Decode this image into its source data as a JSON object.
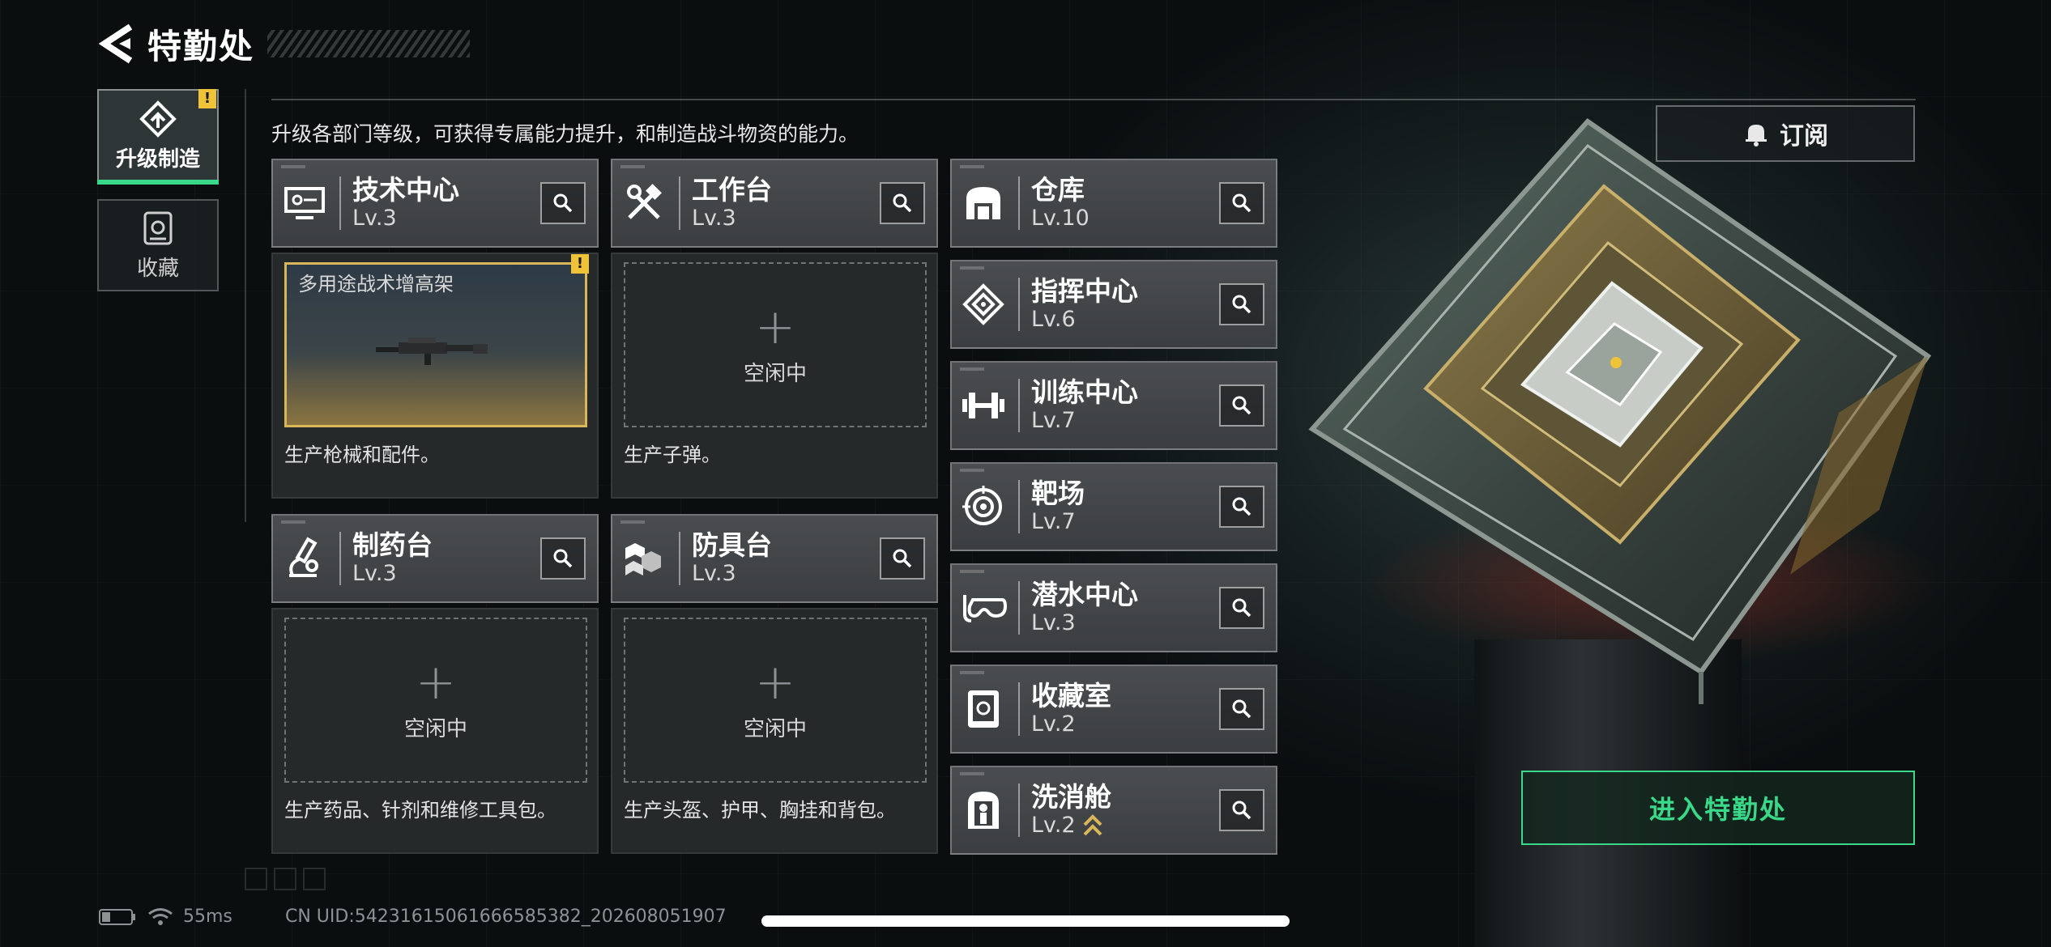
{
  "header": {
    "title": "特勤处"
  },
  "nav": {
    "tabs": [
      {
        "label": "升级制造",
        "badge": "!"
      },
      {
        "label": "收藏"
      }
    ]
  },
  "description": "升级各部门等级，可获得专属能力提升，和制造战斗物资的能力。",
  "subscribe_label": "订阅",
  "departments": {
    "tech_center": {
      "name": "技术中心",
      "level": "Lv.3"
    },
    "workbench": {
      "name": "工作台",
      "level": "Lv.3"
    },
    "pharmacy": {
      "name": "制药台",
      "level": "Lv.3"
    },
    "armor_bench": {
      "name": "防具台",
      "level": "Lv.3"
    },
    "warehouse": {
      "name": "仓库",
      "level": "Lv.10"
    },
    "command_center": {
      "name": "指挥中心",
      "level": "Lv.6"
    },
    "training_center": {
      "name": "训练中心",
      "level": "Lv.7"
    },
    "shooting_range": {
      "name": "靶场",
      "level": "Lv.7"
    },
    "diving_center": {
      "name": "潜水中心",
      "level": "Lv.3"
    },
    "collection_room": {
      "name": "收藏室",
      "level": "Lv.2"
    },
    "decon_chamber": {
      "name": "洗消舱",
      "level": "Lv.2"
    }
  },
  "production": {
    "tech_center": {
      "item": "多用途战术增高架",
      "badge": "!",
      "desc": "生产枪械和配件。"
    },
    "workbench": {
      "plus": "+",
      "status": "空闲中",
      "desc": "生产子弹。"
    },
    "pharmacy": {
      "plus": "+",
      "status": "空闲中",
      "desc": "生产药品、针剂和维修工具包。"
    },
    "armor_bench": {
      "plus": "+",
      "status": "空闲中",
      "desc": "生产头盔、护甲、胸挂和背包。"
    }
  },
  "enter_button": "进入特勤处",
  "status_bar": {
    "ping": "55ms",
    "uid": "CN UID:5423161506166658538​2_202608051907"
  },
  "colors": {
    "accent_green": "#3ad98a",
    "warning_yellow": "#f0c238",
    "slot_gold": "#d9b65a"
  },
  "icons": [
    "back-arrow-icon",
    "upgrade-icon",
    "collection-icon",
    "search-icon",
    "bell-icon",
    "battery-icon",
    "wifi-icon"
  ]
}
